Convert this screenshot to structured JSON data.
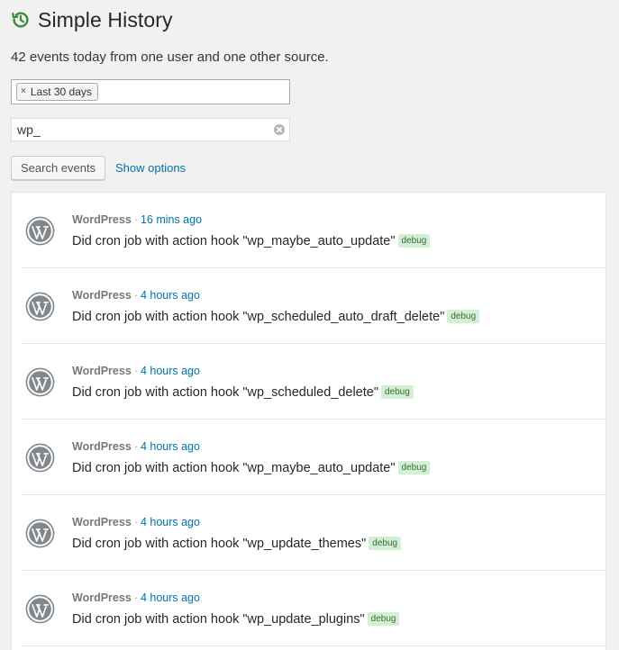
{
  "header": {
    "title": "Simple History"
  },
  "summary": {
    "text": "42 events today from one user and one other source."
  },
  "date_filter": {
    "chip_label": "Last 30 days",
    "remove_glyph": "×"
  },
  "search": {
    "value": "wp_"
  },
  "actions": {
    "search_button": "Search events",
    "show_options": "Show options"
  },
  "events": [
    {
      "source": "WordPress",
      "separator": "·",
      "time": "16 mins ago",
      "message": "Did cron job with action hook \"wp_maybe_auto_update\"",
      "level": "debug"
    },
    {
      "source": "WordPress",
      "separator": "·",
      "time": "4 hours ago",
      "message": "Did cron job with action hook \"wp_scheduled_auto_draft_delete\"",
      "level": "debug"
    },
    {
      "source": "WordPress",
      "separator": "·",
      "time": "4 hours ago",
      "message": "Did cron job with action hook \"wp_scheduled_delete\"",
      "level": "debug"
    },
    {
      "source": "WordPress",
      "separator": "·",
      "time": "4 hours ago",
      "message": "Did cron job with action hook \"wp_maybe_auto_update\"",
      "level": "debug"
    },
    {
      "source": "WordPress",
      "separator": "·",
      "time": "4 hours ago",
      "message": "Did cron job with action hook \"wp_update_themes\"",
      "level": "debug"
    },
    {
      "source": "WordPress",
      "separator": "·",
      "time": "4 hours ago",
      "message": "Did cron job with action hook \"wp_update_plugins\"",
      "level": "debug"
    }
  ],
  "icons": {
    "header": "history-icon",
    "event": "wordpress-logo-icon",
    "clear": "clear-circle-icon"
  },
  "colors": {
    "accent_link": "#0073aa",
    "history_icon": "#3c8a3c",
    "badge_bg": "#d4f0d4",
    "badge_text": "#3a6b3a"
  }
}
